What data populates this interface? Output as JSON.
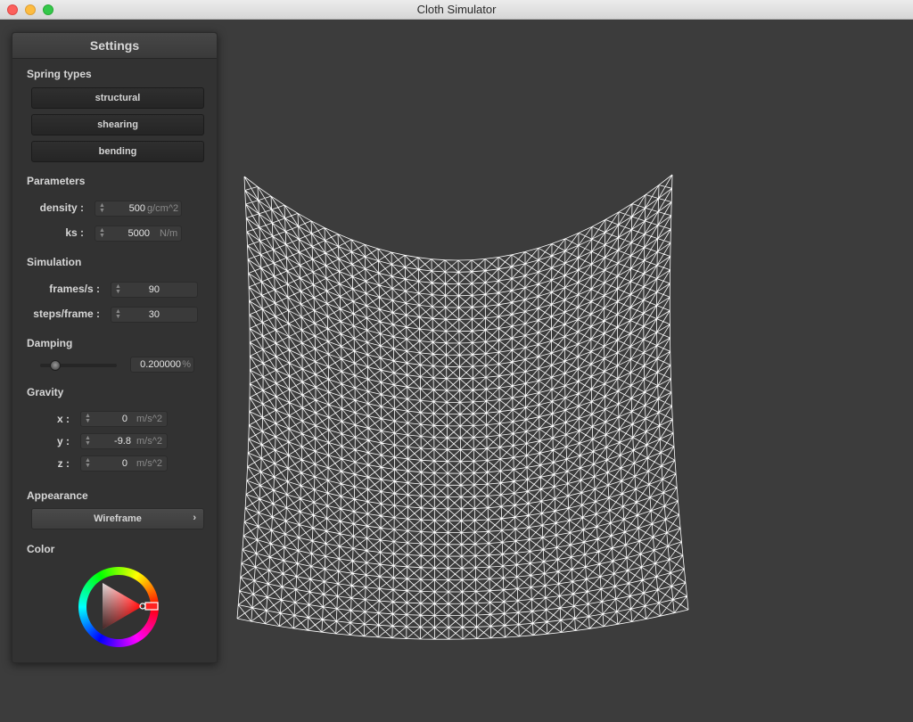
{
  "window": {
    "title": "Cloth Simulator"
  },
  "panel": {
    "title": "Settings",
    "spring_types": {
      "heading": "Spring types",
      "buttons": [
        "structural",
        "shearing",
        "bending"
      ]
    },
    "parameters": {
      "heading": "Parameters",
      "density": {
        "label": "density :",
        "value": "500",
        "unit": "g/cm^2"
      },
      "ks": {
        "label": "ks :",
        "value": "5000",
        "unit": "N/m"
      }
    },
    "simulation": {
      "heading": "Simulation",
      "fps": {
        "label": "frames/s :",
        "value": "90"
      },
      "steps": {
        "label": "steps/frame :",
        "value": "30"
      }
    },
    "damping": {
      "heading": "Damping",
      "value": "0.200000",
      "unit": "%",
      "slider_fraction": 0.2
    },
    "gravity": {
      "heading": "Gravity",
      "x": {
        "label": "x :",
        "value": "0",
        "unit": "m/s^2"
      },
      "y": {
        "label": "y :",
        "value": "-9.8",
        "unit": "m/s^2"
      },
      "z": {
        "label": "z :",
        "value": "0",
        "unit": "m/s^2"
      }
    },
    "appearance": {
      "heading": "Appearance",
      "mode": "Wireframe",
      "chevron": "›"
    },
    "color": {
      "heading": "Color",
      "selected_hue": "#ff0000",
      "icon": "color-wheel-icon"
    }
  },
  "cloth": {
    "render_mode": "wireframe",
    "grid_cols": 32,
    "grid_rows": 32,
    "line_color": "#ffffff"
  }
}
